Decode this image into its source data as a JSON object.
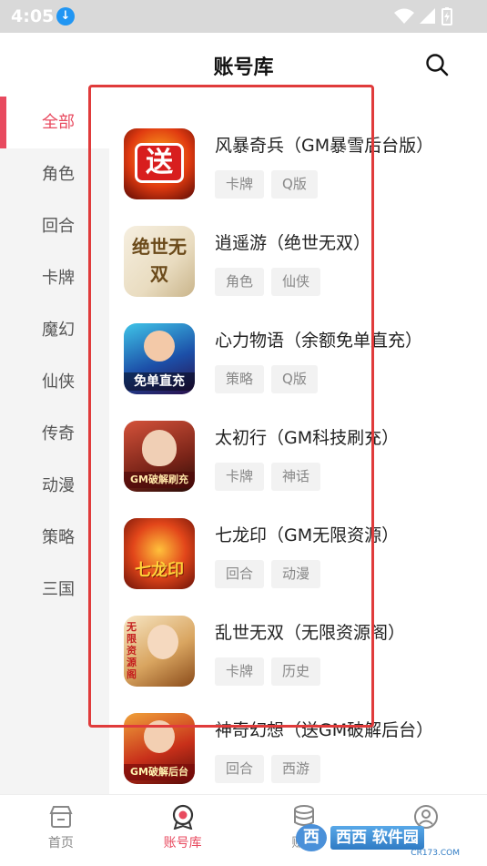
{
  "status_bar": {
    "time": "4:05"
  },
  "header": {
    "title": "账号库"
  },
  "sidebar": {
    "items": [
      {
        "label": "全部",
        "active": true
      },
      {
        "label": "角色"
      },
      {
        "label": "回合"
      },
      {
        "label": "卡牌"
      },
      {
        "label": "魔幻"
      },
      {
        "label": "仙侠"
      },
      {
        "label": "传奇"
      },
      {
        "label": "动漫"
      },
      {
        "label": "策略"
      },
      {
        "label": "三国"
      }
    ]
  },
  "games": [
    {
      "name": "风暴奇兵（GM暴雪后台版）",
      "tags": [
        "卡牌",
        "Q版"
      ],
      "icon_text": "送"
    },
    {
      "name": "逍遥游（绝世无双）",
      "tags": [
        "角色",
        "仙侠"
      ],
      "icon_text": "绝世无双"
    },
    {
      "name": "心力物语（余额免单直充）",
      "tags": [
        "策略",
        "Q版"
      ],
      "icon_text": "免单直充"
    },
    {
      "name": "太初行（GM科技刷充）",
      "tags": [
        "卡牌",
        "神话"
      ],
      "icon_text": "GM破解刷充"
    },
    {
      "name": "七龙印（GM无限资源）",
      "tags": [
        "回合",
        "动漫"
      ],
      "icon_text": "七龙印"
    },
    {
      "name": "乱世无双（无限资源阁）",
      "tags": [
        "卡牌",
        "历史"
      ],
      "icon_text": "无限资源阁"
    },
    {
      "name": "神奇幻想（送GM破解后台）",
      "tags": [
        "回合",
        "西游"
      ],
      "icon_text": "GM破解后台"
    }
  ],
  "bottom_nav": {
    "items": [
      {
        "label": "首页"
      },
      {
        "label": "账号库",
        "active": true
      },
      {
        "label": "赚积"
      },
      {
        "label": ""
      }
    ]
  },
  "watermark": {
    "logo": "西",
    "text": "西西 软件园",
    "sub": "CR173.COM"
  },
  "colors": {
    "accent": "#e84a5f",
    "annotation": "#e03b3b"
  }
}
